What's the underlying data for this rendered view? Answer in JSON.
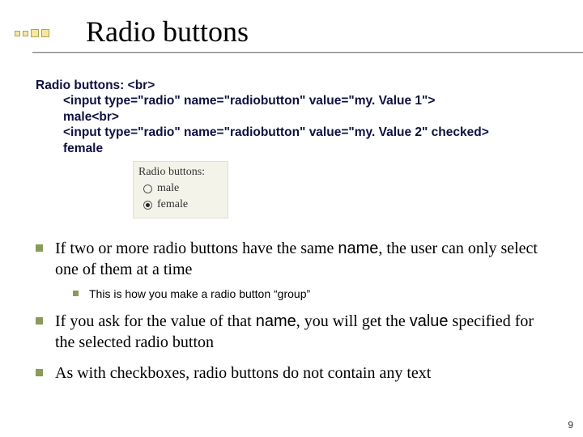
{
  "title": "Radio buttons",
  "code": {
    "line1": "Radio buttons: <br>",
    "line2": "<input type=\"radio\" name=\"radiobutton\" value=\"my. Value 1\">",
    "line3": "male<br>",
    "line4": "<input type=\"radio\" name=\"radiobutton\" value=\"my. Value 2\" checked>",
    "line5": "female"
  },
  "example": {
    "header": "Radio buttons:",
    "opt1": "male",
    "opt2": "female"
  },
  "bullets": {
    "b1_pre": "If two or more radio buttons have the same ",
    "b1_kw": "name",
    "b1_post": ", the user can only select one of them at a time",
    "b1_sub": "This is how you make a radio button “group”",
    "b2_pre": "If you ask for the value of that ",
    "b2_kw1": "name",
    "b2_mid": ", you will get the ",
    "b2_kw2": "value",
    "b2_post": " specified for the selected radio button",
    "b3": "As with checkboxes, radio buttons do not contain any text"
  },
  "slidenum": "9"
}
